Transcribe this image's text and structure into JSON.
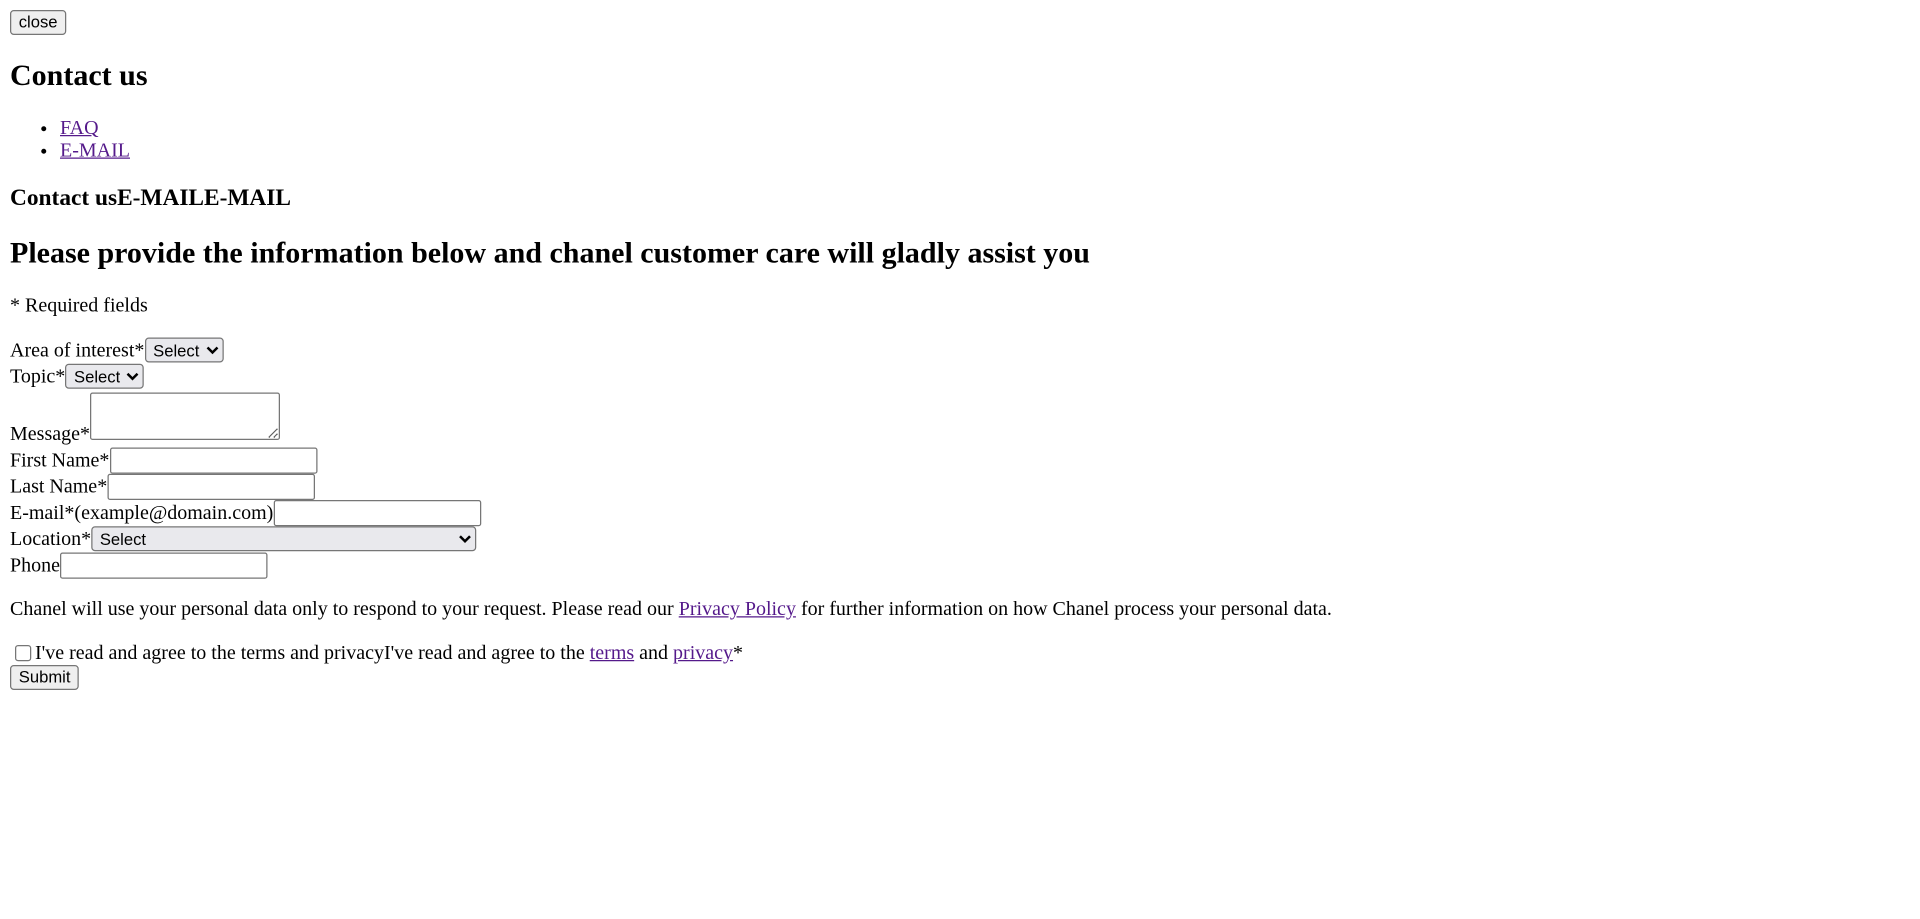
{
  "modal": {
    "close_label": "close"
  },
  "header": {
    "title": "Contact us"
  },
  "nav": {
    "items": [
      {
        "label": "FAQ"
      },
      {
        "label": "E-MAIL"
      }
    ]
  },
  "section": {
    "title": "Contact usE-MAILE-MAIL"
  },
  "form": {
    "lead": "Please provide the information below and chanel customer care will gladly assist you",
    "required_note": "* Required fields",
    "area_label": "Area of interest*",
    "area_value": "Select",
    "topic_label": "Topic*",
    "topic_value": "Select",
    "message_label": "Message*",
    "message_value": "",
    "first_name_label": "First Name*",
    "first_name_value": "",
    "last_name_label": "Last Name*",
    "last_name_value": "",
    "email_label": "E-mail*(example@domain.com)",
    "email_value": "",
    "location_label": "Location*",
    "location_value": "Select",
    "phone_label": "Phone",
    "phone_value": "",
    "privacy_text_before": "Chanel will use your personal data only to respond to your request. Please read our ",
    "privacy_link": "Privacy Policy",
    "privacy_text_after": " for further information on how Chanel process your personal data.",
    "agree_text_hidden": "I've read and agree to the terms and privacy",
    "agree_text_before": "I've read and agree to the ",
    "agree_terms_link": "terms",
    "agree_and": " and ",
    "agree_privacy_link": "privacy",
    "agree_required": "*",
    "submit_label": "Submit"
  }
}
